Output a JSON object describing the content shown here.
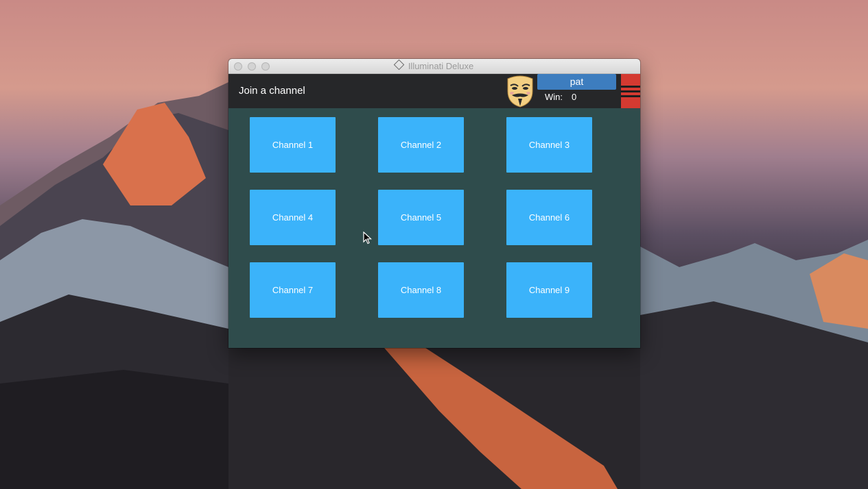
{
  "window": {
    "title": "Illuminati Deluxe"
  },
  "header": {
    "title": "Join a channel",
    "avatar_icon": "guy-fawkes-mask-icon",
    "username": "pat",
    "win_label": "Win:",
    "win_value": "0",
    "menu_icon": "hamburger-menu-icon"
  },
  "channels": [
    {
      "label": "Channel 1"
    },
    {
      "label": "Channel 2"
    },
    {
      "label": "Channel 3"
    },
    {
      "label": "Channel 4"
    },
    {
      "label": "Channel 5"
    },
    {
      "label": "Channel 6"
    },
    {
      "label": "Channel 7"
    },
    {
      "label": "Channel 8"
    },
    {
      "label": "Channel 9"
    }
  ],
  "colors": {
    "content_bg": "#2f4c4c",
    "header_bg": "#262729",
    "channel_button": "#3bb3fa",
    "username_bg": "#3d7dbf",
    "menu_button": "#d43a31"
  }
}
